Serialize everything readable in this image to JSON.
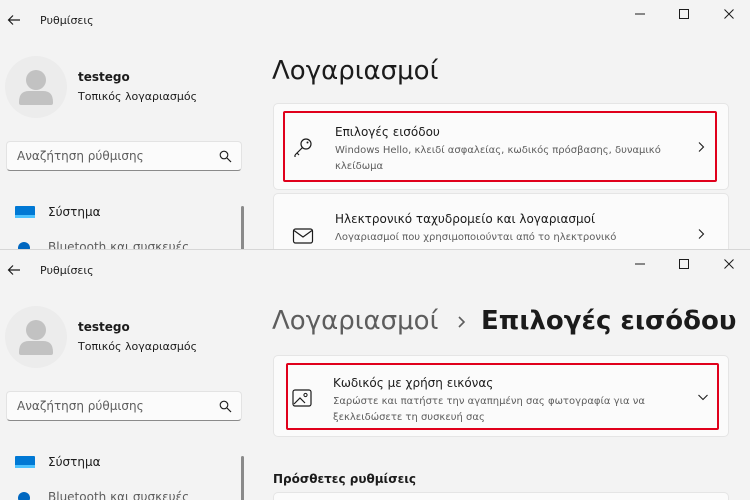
{
  "app": {
    "title": "Ρυθμίσεις"
  },
  "user": {
    "name": "testego",
    "account_type": "Τοπικός λογαριασμός"
  },
  "search": {
    "placeholder": "Αναζήτηση ρύθμισης"
  },
  "nav": {
    "system_label": "Σύστημα",
    "partial_label": "Bluetooth και συσκευές"
  },
  "top": {
    "page_title": "Λογαριασμοί",
    "cards": [
      {
        "title": "Επιλογές εισόδου",
        "desc": "Windows Hello, κλειδί ασφαλείας, κωδικός πρόσβασης, δυναμικό κλείδωμα"
      },
      {
        "title": "Ηλεκτρονικό ταχυδρομείο και λογαριασμοί",
        "desc": "Λογαριασμοί που χρησιμοποιούνται από το ηλεκτρονικό"
      }
    ]
  },
  "bottom": {
    "breadcrumb_parent": "Λογαριασμοί",
    "breadcrumb_current": "Επιλογές εισόδου",
    "card": {
      "title": "Κωδικός με χρήση εικόνας",
      "desc": "Σαρώστε και πατήστε την αγαπημένη σας φωτογραφία για να ξεκλειδώσετε τη συσκευή σας"
    },
    "section_heading": "Πρόσθετες ρυθμίσεις"
  },
  "colors": {
    "accent": "#0067c0",
    "highlight": "#e0001b",
    "background": "#f3f3f3",
    "card": "#fbfbfb"
  },
  "icons": [
    "back-arrow-icon",
    "minimize-icon",
    "maximize-icon",
    "close-icon",
    "user-avatar-icon",
    "search-icon",
    "system-display-icon",
    "bluetooth-icon",
    "key-icon",
    "mail-icon",
    "picture-password-icon",
    "chevron-right-icon",
    "chevron-down-icon"
  ]
}
